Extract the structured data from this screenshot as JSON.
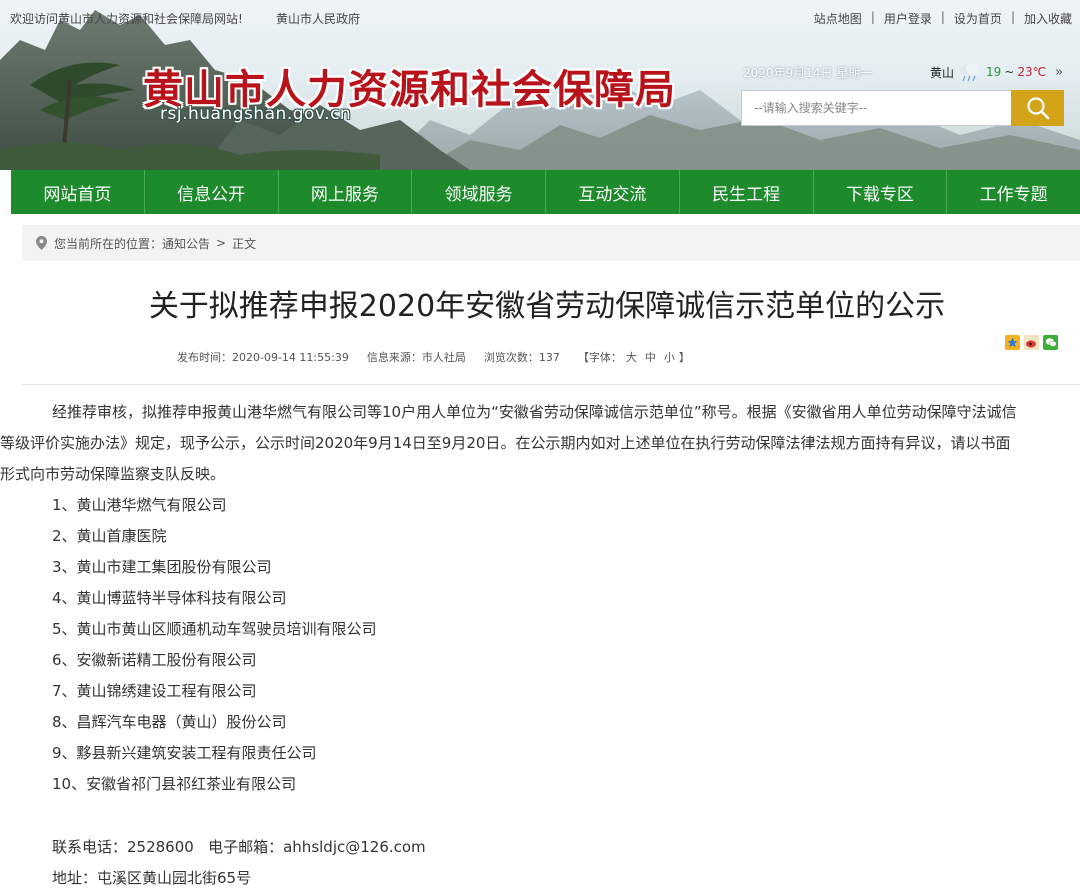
{
  "topbar": {
    "welcome": "欢迎访问黄山市人力资源和社会保障局网站!",
    "gov_link": "黄山市人民政府",
    "links": [
      "站点地图",
      "用户登录",
      "设为首页",
      "加入收藏"
    ]
  },
  "site": {
    "title": "黄山市人力资源和社会保障局",
    "domain": "rsj.huangshan.gov.cn"
  },
  "date": "2020年9月14日 星期一",
  "weather": {
    "city": "黄山",
    "icon": "cloud-rain-icon",
    "low": "19",
    "sep": "~",
    "high": "23℃",
    "more": "»"
  },
  "search": {
    "placeholder": "--请输入搜索关键字--",
    "button_icon": "search-icon"
  },
  "nav": [
    "网站首页",
    "信息公开",
    "网上服务",
    "领域服务",
    "互动交流",
    "民生工程",
    "下载专区",
    "工作专题"
  ],
  "breadcrumb": {
    "prefix": "您当前所在的位置：",
    "section": "通知公告",
    "arrow": ">",
    "current": "正文"
  },
  "article": {
    "title": "关于拟推荐申报2020年安徽省劳动保障诚信示范单位的公示",
    "meta": {
      "published": "发布时间：2020-09-14 11:55:39",
      "source": "信息来源：市人社局",
      "views": "浏览次数：137",
      "font_label": "【字体：",
      "font_large": "大",
      "font_medium": "中",
      "font_small": "小",
      "font_end": "】"
    },
    "intro_lines": [
      "经推荐审核，拟推荐申报黄山港华燃气有限公司等10户用人单位为“安徽省劳动保障诚信示范单位”称号。根据《安徽省用人单位劳动保障守法诚信",
      "等级评价实施办法》规定，现予公示，公示时间2020年9月14日至9月20日。在公示期内如对上述单位在执行劳动保障法律法规方面持有异议，请以书面",
      "形式向市劳动保障监察支队反映。"
    ],
    "companies": [
      "1、黄山港华燃气有限公司",
      "2、黄山首康医院",
      "3、黄山市建工集团股份有限公司",
      "4、黄山博蓝特半导体科技有限公司",
      "5、黄山市黄山区顺通机动车驾驶员培训有限公司",
      "6、安徽新诺精工股份有限公司",
      "7、黄山锦绣建设工程有限公司",
      "8、昌辉汽车电器（黄山）股份公司",
      "9、黟县新兴建筑安装工程有限责任公司",
      "10、安徽省祁门县祁红茶业有限公司"
    ],
    "contact": "联系电话：2528600   电子邮箱：ahhsldjc@126.com",
    "address": "地址：屯溪区黄山园北街65号"
  },
  "colors": {
    "nav_green": "#1d8a2c",
    "title_red": "#b8121b",
    "search_gold": "#d4a418"
  }
}
